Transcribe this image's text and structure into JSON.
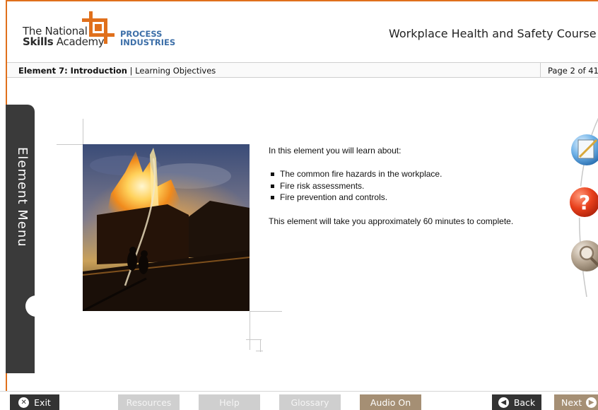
{
  "logo": {
    "line1": "The National",
    "line2_bold": "Skills",
    "line2_rest": " Academy",
    "sub1": "PROCESS",
    "sub2": "INDUSTRIES",
    "brand_orange": "#e0701c",
    "brand_blue": "#3d6fa8"
  },
  "header": {
    "course_title": "Workplace Health and Safety Course"
  },
  "breadcrumb": {
    "element": "Element 7: Introduction",
    "separator": " | ",
    "section": "Learning Objectives",
    "page": "Page 2 of 41"
  },
  "side_menu": {
    "label": "Element Menu"
  },
  "content": {
    "intro": "In this element you will learn about:",
    "bullets": [
      "The common fire hazards in the workplace.",
      "Fire risk assessments.",
      "Fire prevention and controls."
    ],
    "duration": "This element will take you approximately 60 minutes to complete."
  },
  "side_icons": [
    "notepad-icon",
    "help-question-icon",
    "magnifier-icon"
  ],
  "footer": {
    "exit": "Exit",
    "resources": "Resources",
    "help": "Help",
    "glossary": "Glossary",
    "audio": "Audio On",
    "back": "Back",
    "next": "Next"
  }
}
